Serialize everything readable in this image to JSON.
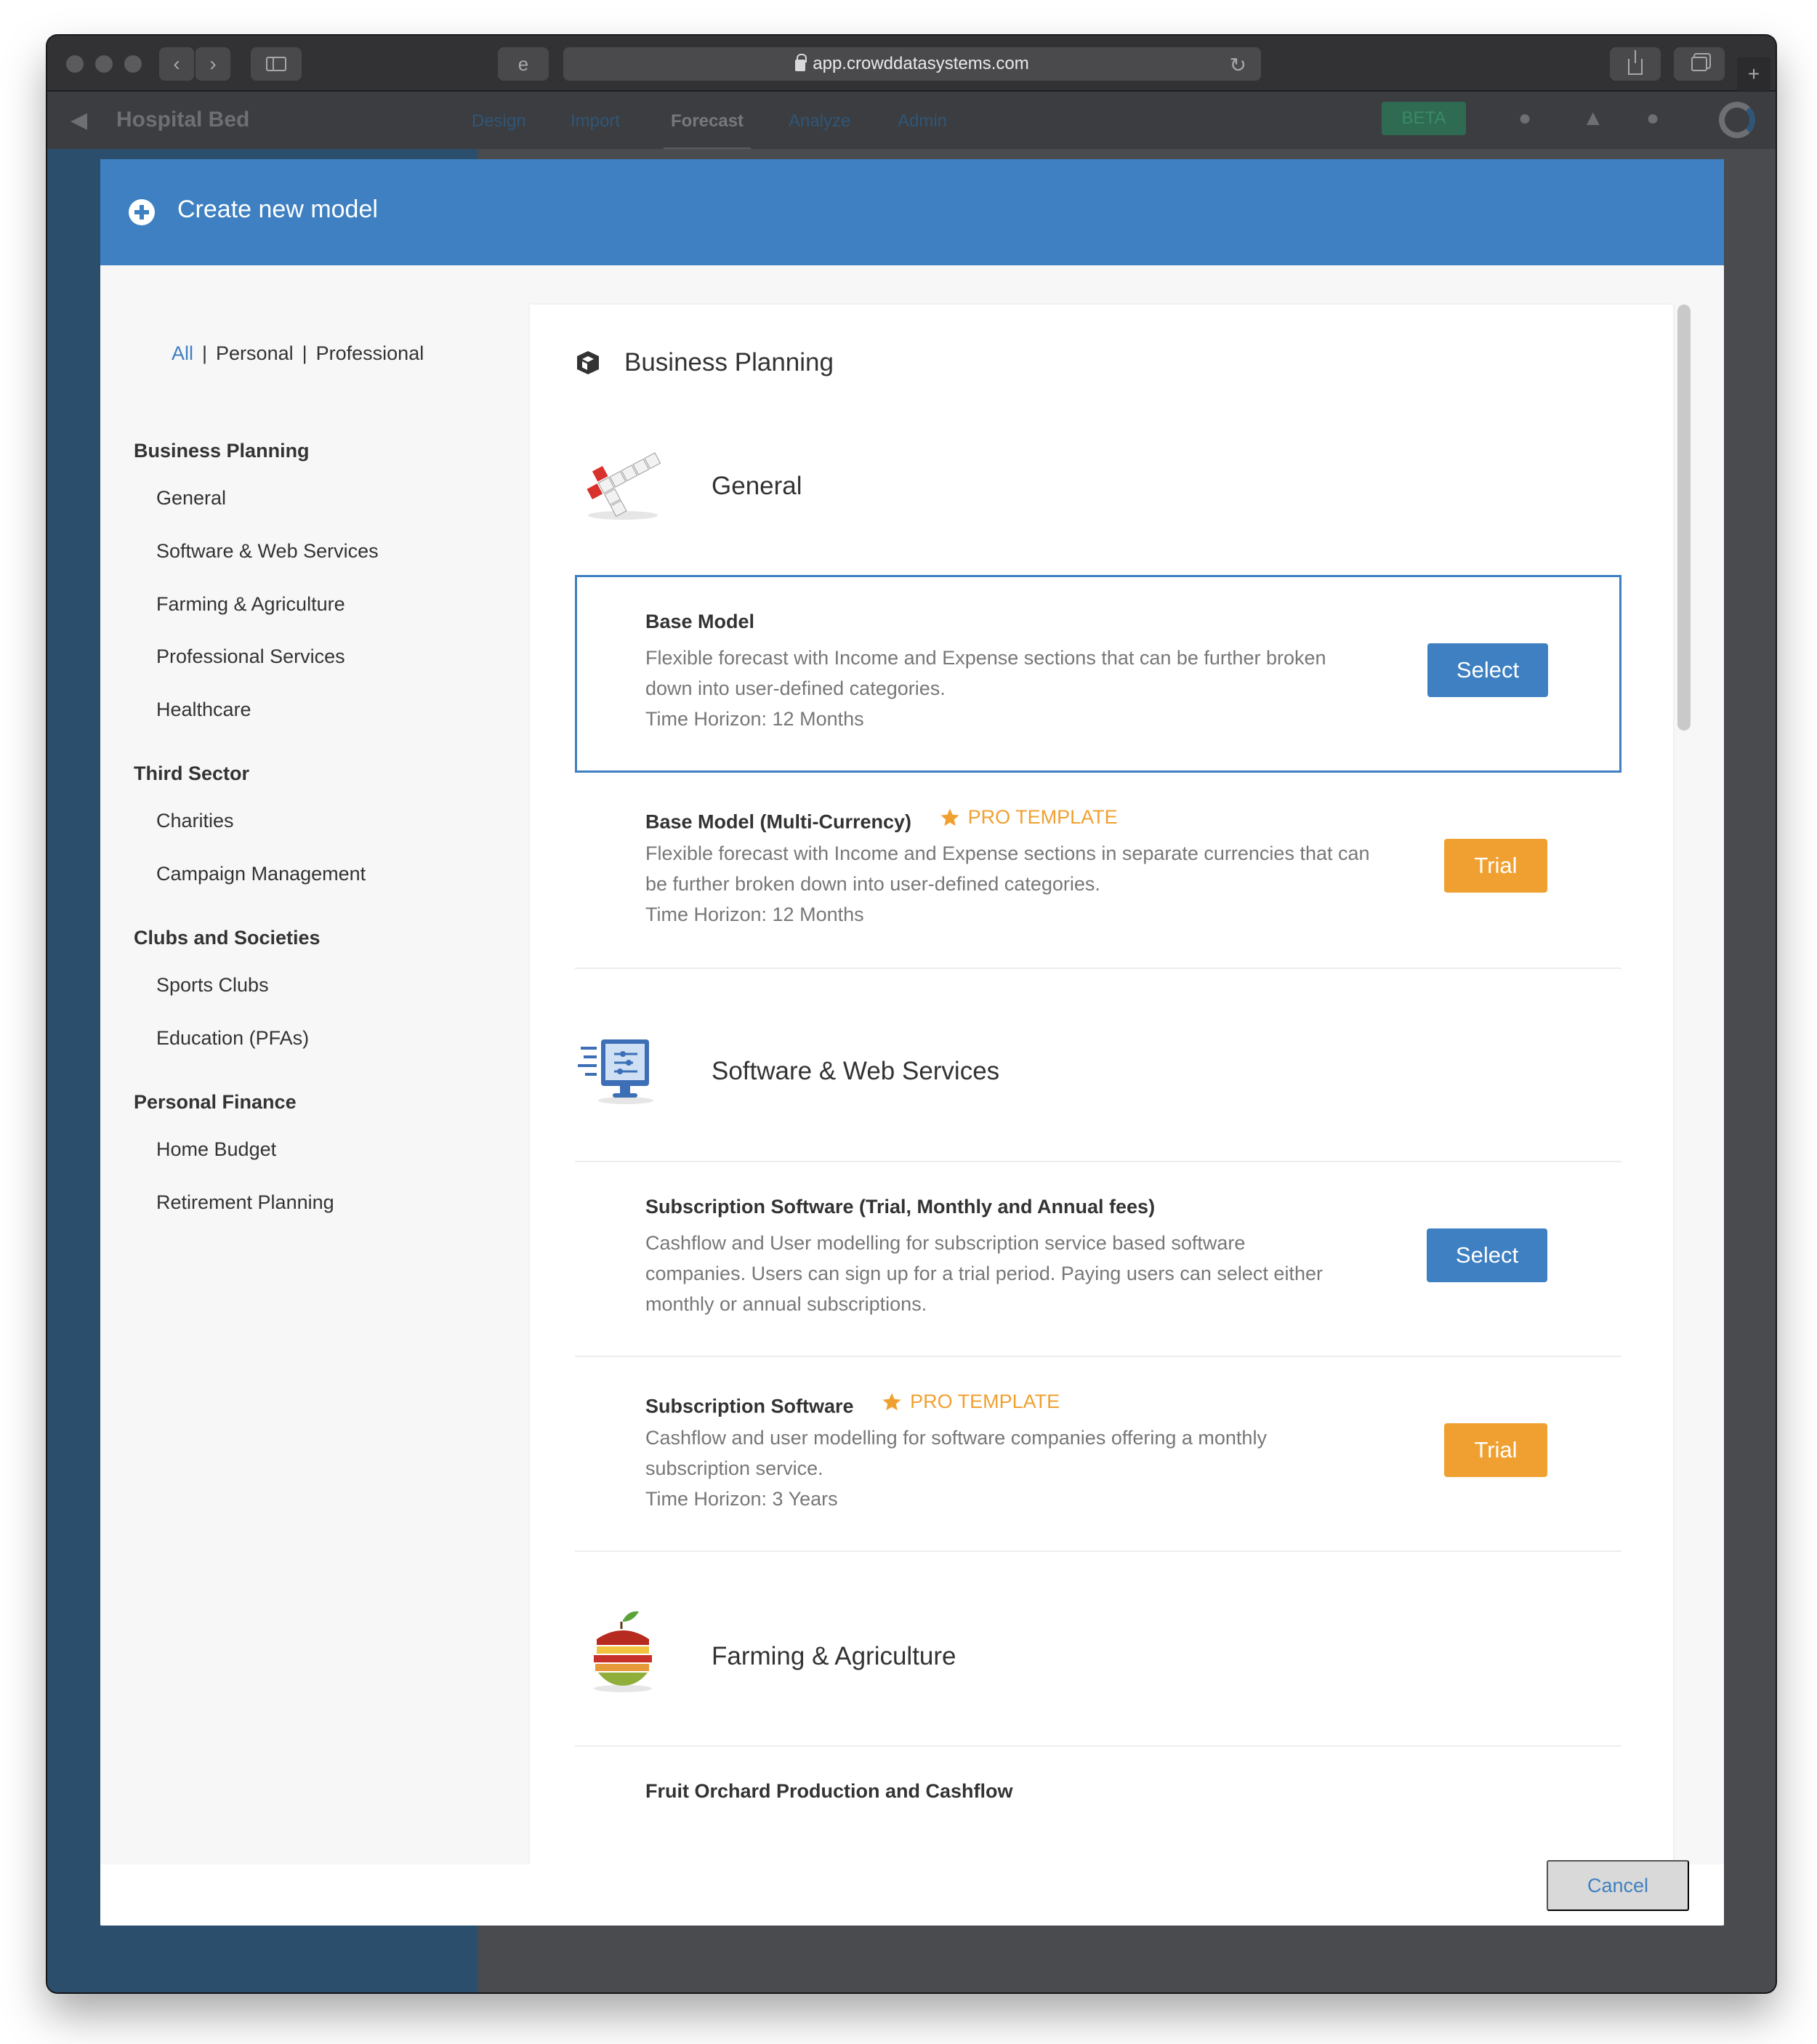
{
  "browser": {
    "url": "app.crowddatasystems.com"
  },
  "app_behind": {
    "title": "Hospital Bed",
    "tabs": [
      "Design",
      "Import",
      "Forecast",
      "Analyze",
      "Admin"
    ],
    "active_tab": "Forecast",
    "badge": "BETA"
  },
  "modal": {
    "title": "Create new model",
    "cancel_label": "Cancel"
  },
  "filters": {
    "items": [
      "All",
      "Personal",
      "Professional"
    ],
    "active": "All",
    "separator": "|"
  },
  "sidebar": {
    "categories": [
      {
        "label": "Business Planning",
        "items": [
          "General",
          "Software & Web Services",
          "Farming & Agriculture",
          "Professional Services",
          "Healthcare"
        ]
      },
      {
        "label": "Third Sector",
        "items": [
          "Charities",
          "Campaign Management"
        ]
      },
      {
        "label": "Clubs and Societies",
        "items": [
          "Sports Clubs",
          "Education (PFAs)"
        ]
      },
      {
        "label": "Personal Finance",
        "items": [
          "Home Budget",
          "Retirement Planning"
        ]
      }
    ]
  },
  "content": {
    "section_title": "Business Planning",
    "section_icon": "cube-icon",
    "groups": [
      {
        "title": "General",
        "icon": "profit-loss-tiles-image",
        "models": [
          {
            "title": "Base Model",
            "pro": false,
            "desc_lines": [
              "Flexible forecast with Income and Expense sections that can be further broken",
              "down into user-defined categories.",
              "Time Horizon: 12 Months"
            ],
            "action": "Select",
            "selected": true
          },
          {
            "title": "Base Model (Multi-Currency)",
            "pro": true,
            "pro_label": "PRO TEMPLATE",
            "desc_lines": [
              "Flexible forecast with Income and Expense sections in separate currencies that can",
              "be further broken down into user-defined categories.",
              "Time Horizon: 12 Months"
            ],
            "action": "Trial",
            "selected": false
          }
        ]
      },
      {
        "title": "Software & Web Services",
        "icon": "software-monitor-image",
        "models": [
          {
            "title": "Subscription Software (Trial, Monthly and Annual fees)",
            "pro": false,
            "desc_lines": [
              "Cashflow and User modelling for subscription service based software",
              "companies. Users can sign up for a trial period. Paying users can select either",
              "monthly or annual subscriptions."
            ],
            "action": "Select",
            "selected": false
          },
          {
            "title": "Subscription Software",
            "pro": true,
            "pro_label": "PRO TEMPLATE",
            "desc_lines": [
              "Cashflow and user modelling for software companies offering a monthly",
              "subscription service.",
              "Time Horizon: 3 Years"
            ],
            "action": "Trial",
            "selected": false
          }
        ]
      },
      {
        "title": "Farming & Agriculture",
        "icon": "apple-slices-image",
        "models": [
          {
            "title": "Fruit Orchard Production and Cashflow",
            "pro": false
          }
        ]
      }
    ]
  },
  "colors": {
    "accent": "#3e80c1",
    "pro": "#f0a030",
    "trial": "#f0a030"
  }
}
